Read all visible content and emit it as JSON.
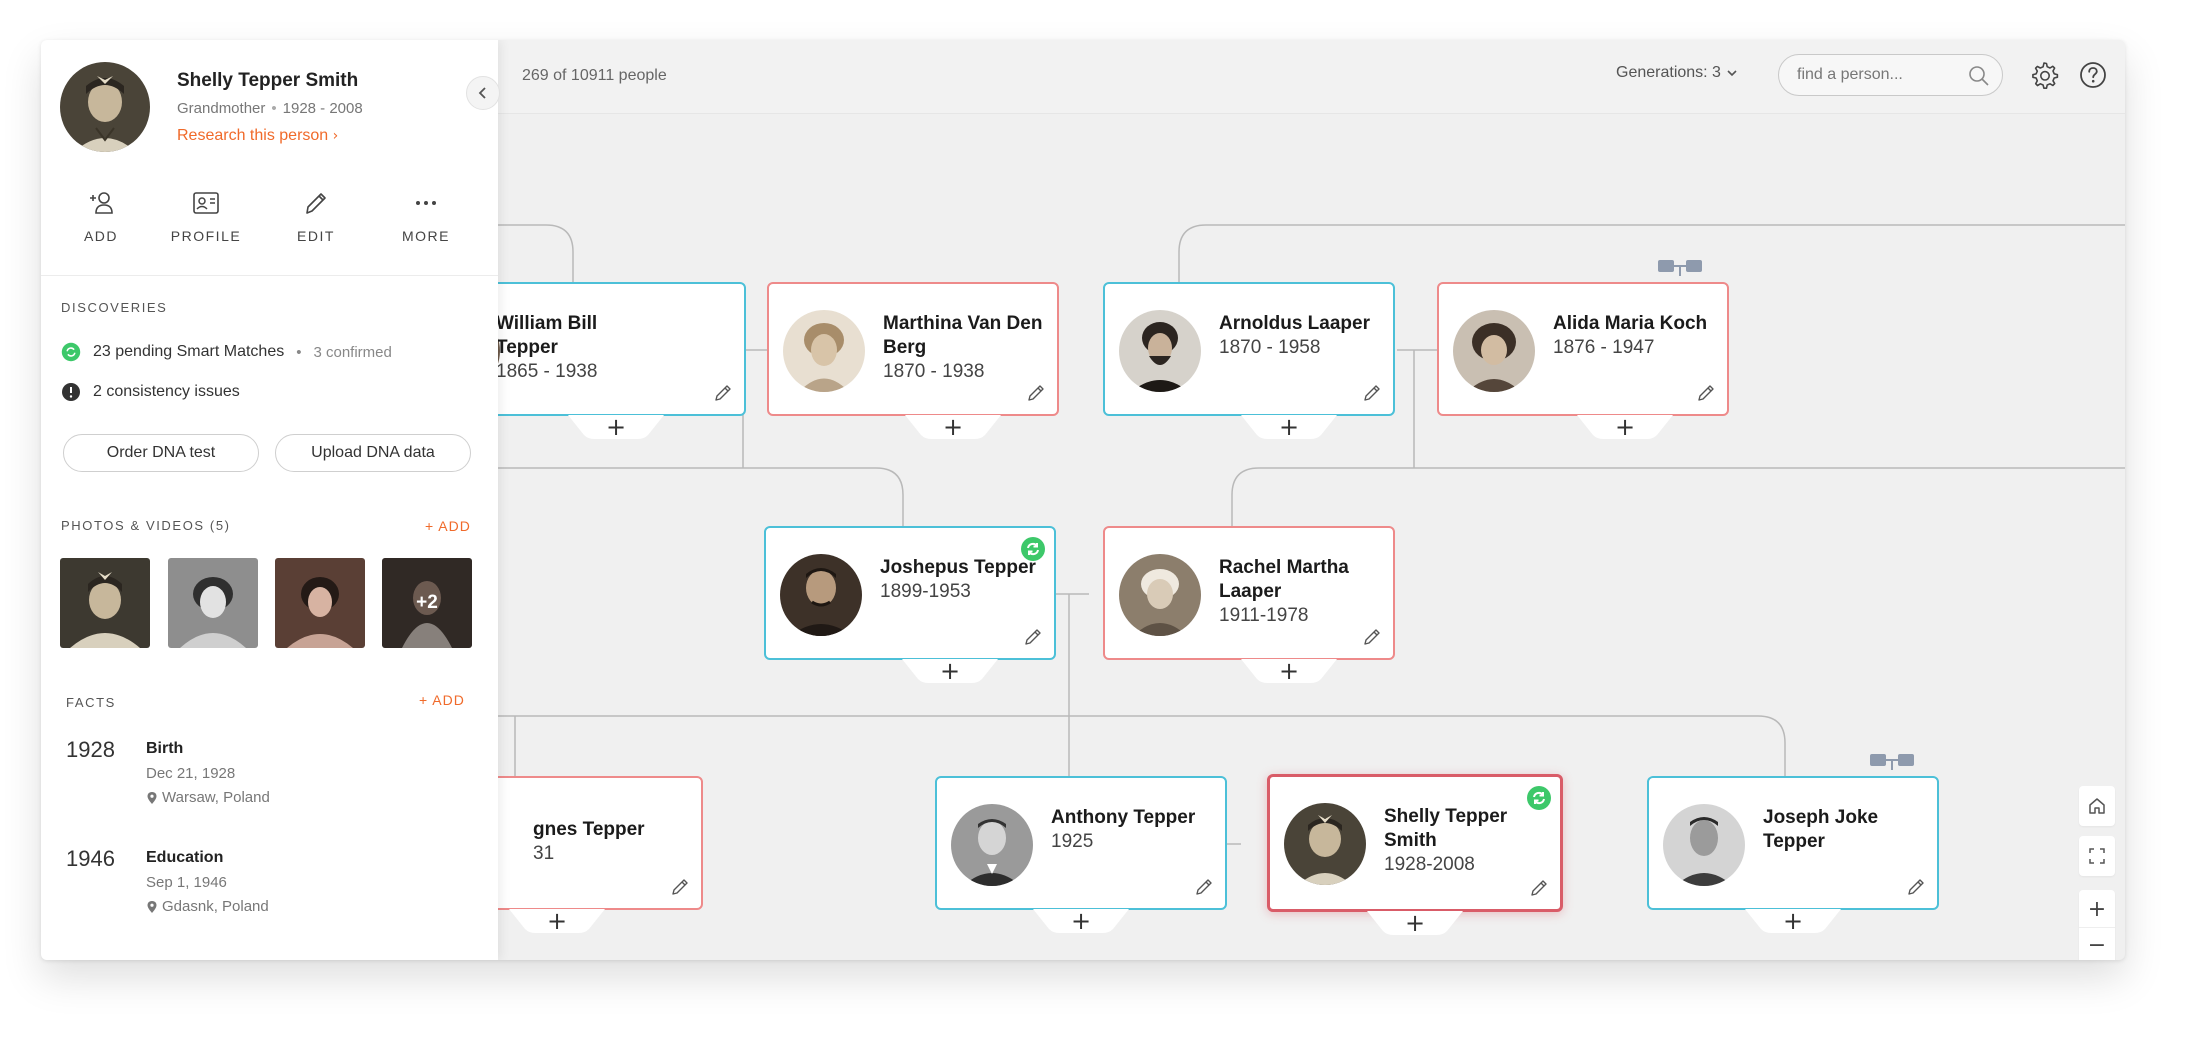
{
  "topbar": {
    "people_count": "269 of 10911 people",
    "generations_label": "Generations: 3",
    "search_placeholder": "find a person..."
  },
  "panel": {
    "name": "Shelly Tepper Smith",
    "role": "Grandmother",
    "years": "1928 - 2008",
    "research_link": "Research this person",
    "actions": [
      {
        "label": "ADD",
        "icon": "add-person-icon"
      },
      {
        "label": "PROFILE",
        "icon": "profile-card-icon"
      },
      {
        "label": "EDIT",
        "icon": "pencil-icon"
      },
      {
        "label": "MORE",
        "icon": "more-dots-icon"
      }
    ],
    "discoveries": {
      "title": "DISCOVERIES",
      "smart_matches": "23 pending Smart Matches",
      "confirmed": "3 confirmed",
      "consistency": "2 consistency issues",
      "order_dna": "Order DNA test",
      "upload_dna": "Upload DNA data"
    },
    "photos": {
      "title": "PHOTOS & VIDEOS (5)",
      "add": "+ ADD",
      "more_count": "+2"
    },
    "facts": {
      "title": "FACTS",
      "add": "+ ADD",
      "items": [
        {
          "year": "1928",
          "title": "Birth",
          "date": "Dec 21, 1928",
          "place": "Warsaw, Poland"
        },
        {
          "year": "1946",
          "title": "Education",
          "date": "Sep 1, 1946",
          "place": "Gdasnk, Poland"
        }
      ]
    }
  },
  "tree": {
    "people": [
      {
        "name": "William Bill Tepper",
        "years": "1865 - 1938",
        "gender": "male"
      },
      {
        "name": "Marthina Van Den Berg",
        "years": "1870 - 1938",
        "gender": "female"
      },
      {
        "name": "Arnoldus Laaper",
        "years": "1870 - 1958",
        "gender": "male"
      },
      {
        "name": "Alida Maria Koch",
        "years": "1876 - 1947",
        "gender": "female"
      },
      {
        "name": "Joshepus Tepper",
        "years": "1899-1953",
        "gender": "male"
      },
      {
        "name": "Rachel Martha Laaper",
        "years": "1911-1978",
        "gender": "female"
      },
      {
        "name": "gnes Tepper",
        "years": "31",
        "gender": "female"
      },
      {
        "name": "Anthony Tepper",
        "years": "1925",
        "gender": "male"
      },
      {
        "name": "Shelly Tepper Smith",
        "years": "1928-2008",
        "gender": "female"
      },
      {
        "name": "Joseph Joke Tepper",
        "years": "",
        "gender": "male"
      }
    ],
    "plus_label": "+"
  },
  "zoom": {
    "zoom_in": "+",
    "zoom_out": "−"
  },
  "colors": {
    "male_border": "#4cc0d8",
    "female_border": "#ee8a8a",
    "selected_border": "#d95c68",
    "accent": "#f06a2a",
    "match_green": "#3dc86a"
  }
}
